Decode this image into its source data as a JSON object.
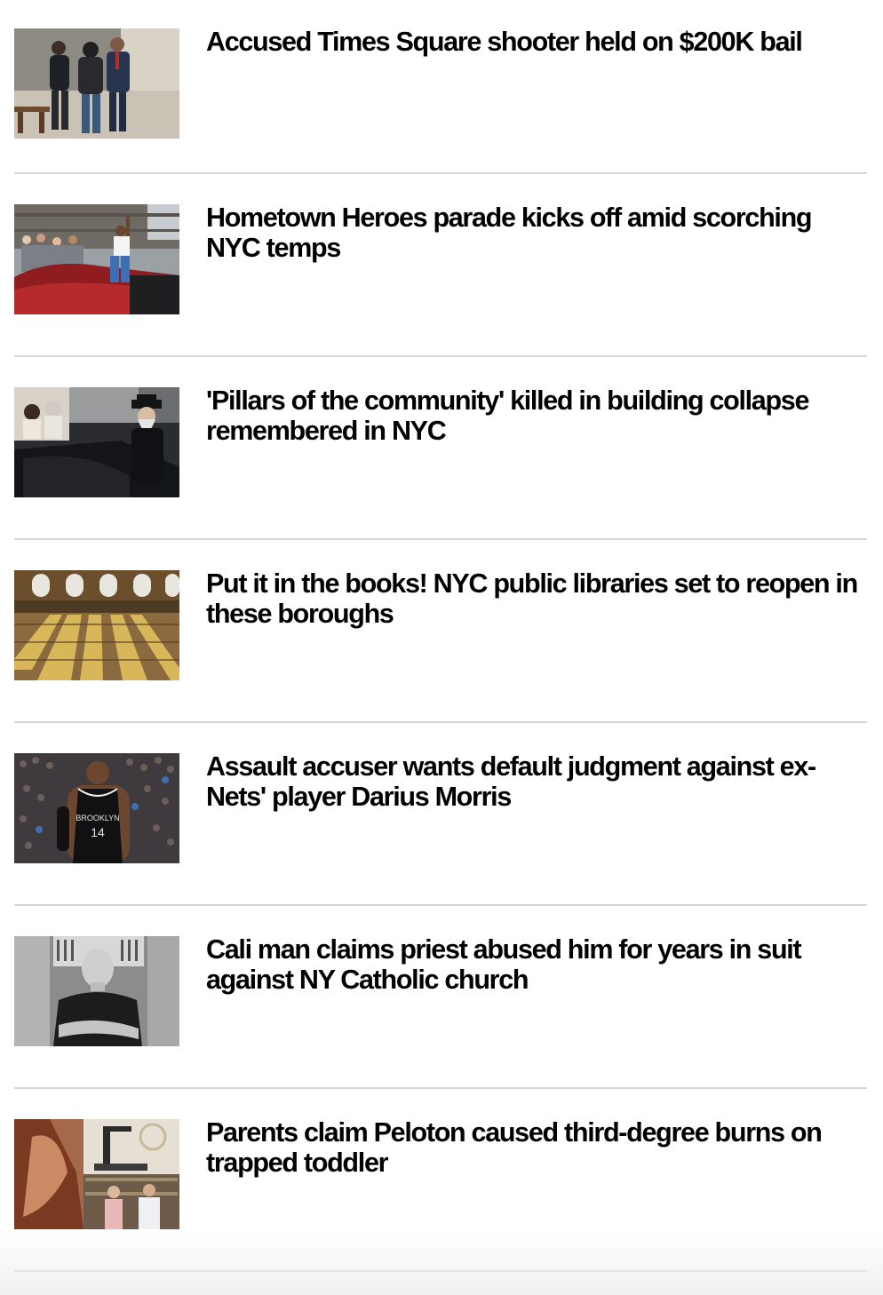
{
  "stories": [
    {
      "headline": "Accused Times Square shooter held on $200K bail",
      "image_subject": "court-escort-photo"
    },
    {
      "headline": "Hometown Heroes parade kicks off amid scorching NYC temps",
      "image_subject": "parade-convertible-photo"
    },
    {
      "headline": "'Pillars of the community' killed in building collapse remembered in NYC",
      "image_subject": "funeral-procession-photo"
    },
    {
      "headline": "Put it in the books! NYC public libraries set to reopen in these boroughs",
      "image_subject": "library-reading-room-photo"
    },
    {
      "headline": "Assault accuser wants default judgment against ex-Nets' player Darius Morris",
      "image_subject": "basketball-player-photo"
    },
    {
      "headline": "Cali man claims priest abused him for years in suit against NY Catholic church",
      "image_subject": "portrait-man-photo"
    },
    {
      "headline": "Parents claim Peloton caused third-degree burns on trapped toddler",
      "image_subject": "peloton-collage-photo"
    }
  ],
  "colors": {
    "headline": "#000000",
    "divider": "#d6d6d6",
    "background": "#ffffff"
  }
}
